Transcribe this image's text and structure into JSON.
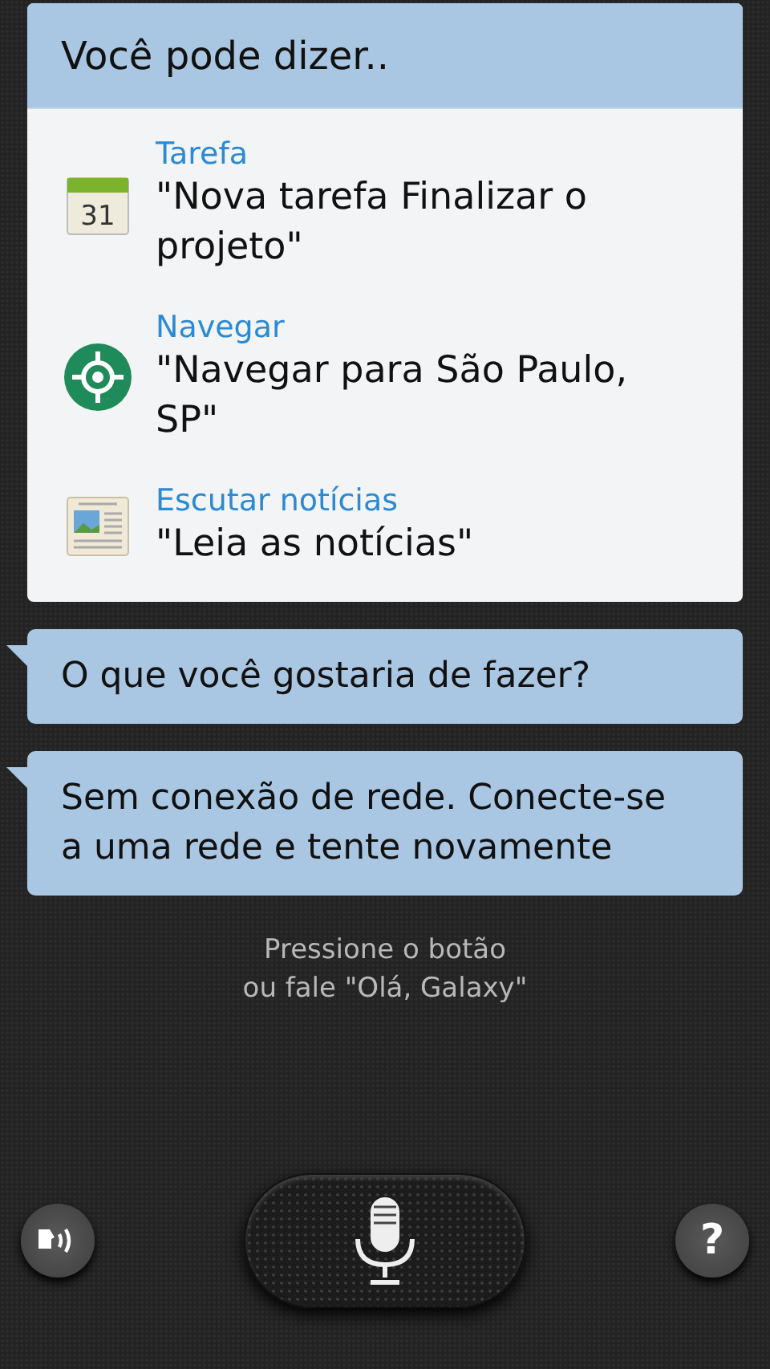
{
  "suggestions": {
    "title": "Você pode dizer..",
    "items": [
      {
        "kind": "calendar",
        "icon_label": "31",
        "category": "Tarefa",
        "example": "\"Nova tarefa Finalizar o projeto\""
      },
      {
        "kind": "navigation",
        "category": "Navegar",
        "example": "\"Navegar para São Paulo, SP\""
      },
      {
        "kind": "news",
        "category": "Escutar notícias",
        "example": "\"Leia as notícias\""
      }
    ]
  },
  "messages": [
    "O que você gostaria de fazer?",
    "Sem conexão de rede. Conecte-se a uma rede e tente novamente"
  ],
  "hint": [
    "Pressione o botão",
    "ou fale \"Olá, Galaxy\""
  ],
  "help_button": "?"
}
